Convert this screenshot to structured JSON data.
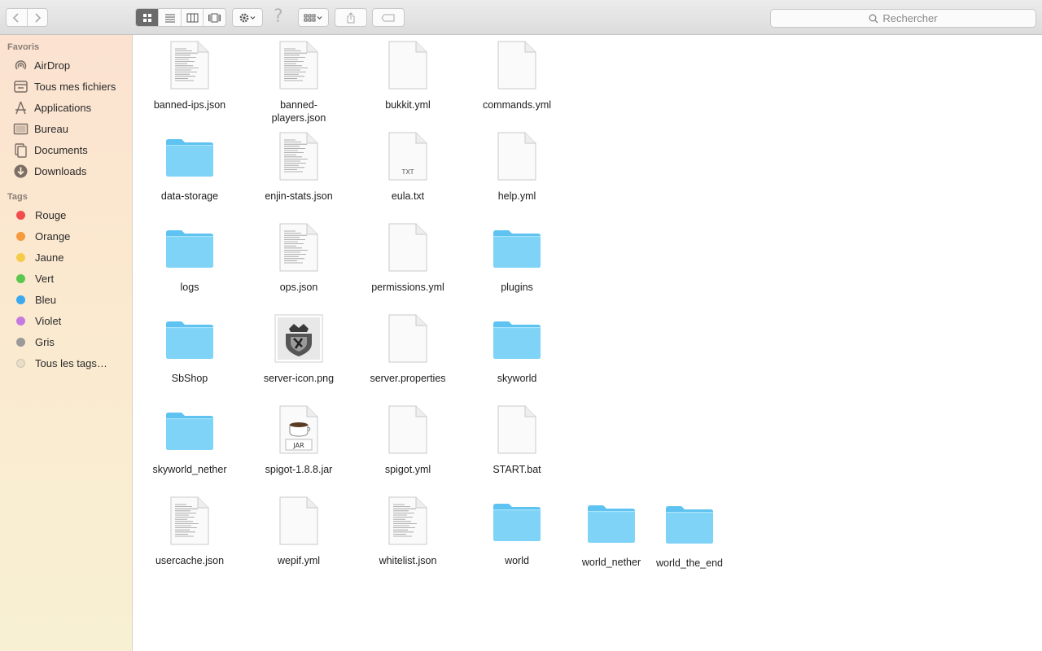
{
  "toolbar": {
    "search_placeholder": "Rechercher"
  },
  "sidebar": {
    "favorites_header": "Favoris",
    "favorites": [
      {
        "label": "AirDrop",
        "icon": "airdrop-icon"
      },
      {
        "label": "Tous mes fichiers",
        "icon": "all-files-icon"
      },
      {
        "label": "Applications",
        "icon": "applications-icon"
      },
      {
        "label": "Bureau",
        "icon": "desktop-icon"
      },
      {
        "label": "Documents",
        "icon": "documents-icon"
      },
      {
        "label": "Downloads",
        "icon": "downloads-icon"
      }
    ],
    "tags_header": "Tags",
    "tags": [
      {
        "label": "Rouge",
        "color": "#f24d4d"
      },
      {
        "label": "Orange",
        "color": "#f59a3d"
      },
      {
        "label": "Jaune",
        "color": "#f4cc4a"
      },
      {
        "label": "Vert",
        "color": "#5bc74f"
      },
      {
        "label": "Bleu",
        "color": "#3aa9f0"
      },
      {
        "label": "Violet",
        "color": "#c47be0"
      },
      {
        "label": "Gris",
        "color": "#9a9a9a"
      },
      {
        "label": "Tous les tags…",
        "color": "#e0d8c8"
      }
    ]
  },
  "files": [
    {
      "name": "banned-ips.json",
      "kind": "textdoc"
    },
    {
      "name": "banned-players.json",
      "kind": "textdoc"
    },
    {
      "name": "bukkit.yml",
      "kind": "blank"
    },
    {
      "name": "commands.yml",
      "kind": "blank"
    },
    {
      "name": "data-storage",
      "kind": "folder"
    },
    {
      "name": "enjin-stats.json",
      "kind": "textdoc"
    },
    {
      "name": "eula.txt",
      "kind": "txt"
    },
    {
      "name": "help.yml",
      "kind": "blank"
    },
    {
      "name": "logs",
      "kind": "folder"
    },
    {
      "name": "ops.json",
      "kind": "textdoc"
    },
    {
      "name": "permissions.yml",
      "kind": "blank"
    },
    {
      "name": "plugins",
      "kind": "folder"
    },
    {
      "name": "SbShop",
      "kind": "folder"
    },
    {
      "name": "server-icon.png",
      "kind": "image"
    },
    {
      "name": "server.properties",
      "kind": "blank"
    },
    {
      "name": "skyworld",
      "kind": "folder"
    },
    {
      "name": "skyworld_nether",
      "kind": "folder"
    },
    {
      "name": "spigot-1.8.8.jar",
      "kind": "jar"
    },
    {
      "name": "spigot.yml",
      "kind": "blank"
    },
    {
      "name": "START.bat",
      "kind": "blank"
    },
    {
      "name": "usercache.json",
      "kind": "textdoc"
    },
    {
      "name": "wepif.yml",
      "kind": "blank"
    },
    {
      "name": "whitelist.json",
      "kind": "textdoc"
    },
    {
      "name": "world",
      "kind": "folder"
    },
    {
      "name": "world_nether",
      "kind": "folder"
    },
    {
      "name": "world_the_end",
      "kind": "folder"
    }
  ],
  "icon_labels": {
    "txt": "TXT",
    "jar": "JAR"
  }
}
